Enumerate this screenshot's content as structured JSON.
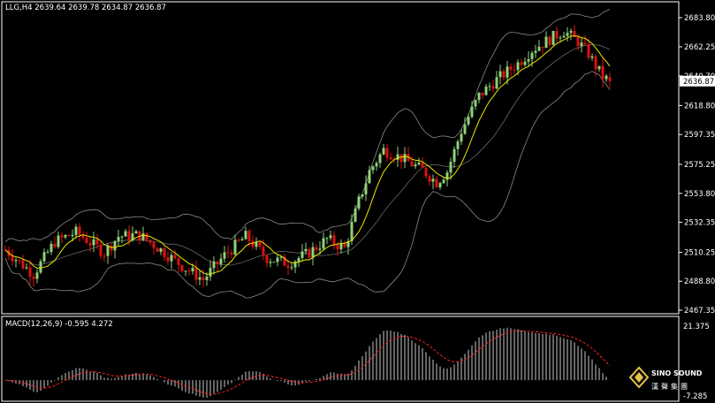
{
  "header": {
    "symbol_label": "LLG,H4 2639.64 2639.78 2634.87 2636.87"
  },
  "macd_header": "MACD(12,26,9) -0.595 4.272",
  "brand": {
    "name": "SINO SOUND",
    "chinese": "漢聲集團"
  },
  "colors": {
    "background": "#000000",
    "up": "#8fd17a",
    "down": "#e01010",
    "ma": "#e8e800",
    "band": "#8a8a8a",
    "macd_hist": "#c8c8c8",
    "macd_signal": "#ff2020",
    "axis_text": "#ffffff"
  },
  "chart_data": [
    {
      "type": "candlestick",
      "title": "LLG,H4",
      "ohlc_last": {
        "open": 2639.64,
        "high": 2639.78,
        "low": 2634.87,
        "close": 2636.87
      },
      "current_price": 2636.87,
      "ylim": [
        2467.35,
        2683.8
      ],
      "y_ticks": [
        2683.8,
        2662.25,
        2640.7,
        2618.8,
        2597.35,
        2575.25,
        2553.8,
        2532.35,
        2510.25,
        2488.8,
        2467.35
      ],
      "y_tick_labels": [
        "2683.80",
        "2662.25",
        "2640.70",
        "2618.80",
        "2597.35",
        "2575.25",
        "2553.80",
        "2532.35",
        "2510.25",
        "2488.80",
        "2467.35"
      ],
      "indicators": [
        "Bollinger Bands",
        "Moving Average"
      ],
      "anchors": [
        [
          0,
          2512
        ],
        [
          8,
          2494
        ],
        [
          14,
          2518
        ],
        [
          20,
          2525
        ],
        [
          28,
          2510
        ],
        [
          32,
          2522
        ],
        [
          38,
          2523
        ],
        [
          44,
          2512
        ],
        [
          50,
          2500
        ],
        [
          56,
          2490
        ],
        [
          62,
          2508
        ],
        [
          68,
          2522
        ],
        [
          74,
          2506
        ],
        [
          80,
          2502
        ],
        [
          86,
          2510
        ],
        [
          91,
          2520
        ],
        [
          96,
          2513
        ],
        [
          100,
          2548
        ],
        [
          103,
          2570
        ],
        [
          107,
          2586
        ],
        [
          112,
          2580
        ],
        [
          118,
          2571
        ],
        [
          122,
          2562
        ],
        [
          125,
          2570
        ],
        [
          129,
          2600
        ],
        [
          134,
          2626
        ],
        [
          139,
          2638
        ],
        [
          145,
          2650
        ],
        [
          149,
          2660
        ],
        [
          154,
          2668
        ],
        [
          158,
          2674
        ],
        [
          162,
          2666
        ],
        [
          165,
          2657
        ],
        [
          167,
          2648
        ],
        [
          169,
          2640
        ],
        [
          171,
          2637
        ]
      ]
    },
    {
      "type": "histogram",
      "title": "MACD(12,26,9)",
      "macd": -0.595,
      "signal": 4.272,
      "ylim": [
        -7.285,
        21.375
      ],
      "y_tick_labels": [
        "21.375",
        "-7.285"
      ]
    }
  ]
}
